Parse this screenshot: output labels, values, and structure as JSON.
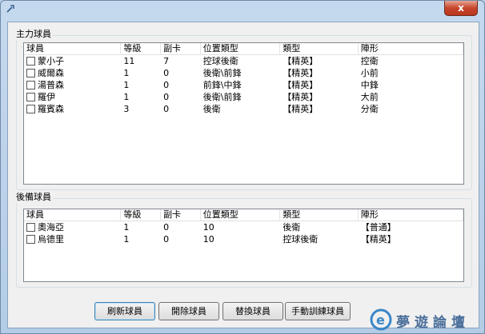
{
  "window": {
    "close_label": "x"
  },
  "main_group": {
    "label": "主力球員",
    "columns": [
      "球員",
      "等級",
      "副卡",
      "位置類型",
      "類型",
      "陣形"
    ],
    "rows": [
      {
        "name": "蒙小子",
        "level": "11",
        "sub": "7",
        "position": "控球後衛",
        "type": "【精英】",
        "formation": "控衛"
      },
      {
        "name": "威爾森",
        "level": "1",
        "sub": "0",
        "position": "後衛\\前鋒",
        "type": "【精英】",
        "formation": "小前"
      },
      {
        "name": "湯普森",
        "level": "1",
        "sub": "0",
        "position": "前鋒\\中鋒",
        "type": "【精英】",
        "formation": "中鋒"
      },
      {
        "name": "羅伊",
        "level": "1",
        "sub": "0",
        "position": "後衛\\前鋒",
        "type": "【精英】",
        "formation": "大前"
      },
      {
        "name": "羅賓森",
        "level": "3",
        "sub": "0",
        "position": "後衛",
        "type": "【精英】",
        "formation": "分衛"
      }
    ]
  },
  "reserve_group": {
    "label": "後備球員",
    "columns": [
      "球員",
      "等級",
      "副卡",
      "位置類型",
      "類型",
      "陣形"
    ],
    "rows": [
      {
        "name": "奧海亞",
        "level": "1",
        "sub": "0",
        "position": "10",
        "type": "後衛",
        "formation": "【普通】"
      },
      {
        "name": "烏德里",
        "level": "1",
        "sub": "0",
        "position": "10",
        "type": "控球後衛",
        "formation": "【精英】"
      }
    ]
  },
  "buttons": {
    "refresh": "刷新球員",
    "fire": "開除球員",
    "swap": "替換球員",
    "manual_train": "手動訓練球員"
  },
  "watermark": {
    "text": "夢遊論壇"
  }
}
